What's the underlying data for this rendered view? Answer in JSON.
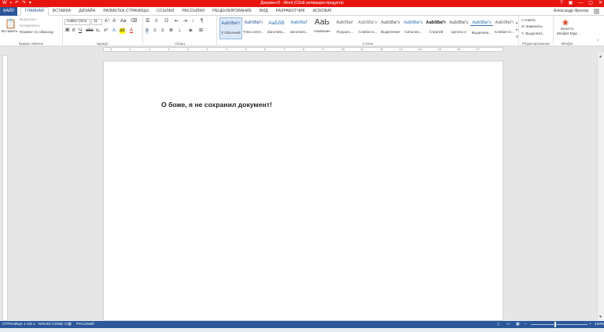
{
  "window": {
    "title": "Документ2 - Word (Сбой активации продукта)",
    "quick_access": [
      "word-icon",
      "save-icon",
      "undo-icon",
      "redo-icon",
      "customize-icon"
    ],
    "controls": [
      "?",
      "▣",
      "—",
      "▢",
      "✕"
    ]
  },
  "tabs": {
    "file": "ФАЙЛ",
    "items": [
      "ГЛАВНАЯ",
      "ВСТАВКА",
      "ДИЗАЙН",
      "РАЗМЕТКА СТРАНИЦЫ",
      "ССЫЛКИ",
      "РАССЫЛКИ",
      "РЕЦЕНЗИРОВАНИЕ",
      "ВИД",
      "РАЗРАБОТЧИК",
      "ACROBAT"
    ],
    "active": "ГЛАВНАЯ",
    "user": "Александр Фролов"
  },
  "ribbon": {
    "clipboard": {
      "paste": "Вставить",
      "cut": "Вырезать",
      "copy": "Копировать",
      "format_painter": "Формат по образцу",
      "label": "Буфер обмена"
    },
    "font": {
      "name": "Calibri (Осн",
      "size": "11",
      "label": "Шрифт"
    },
    "paragraph": {
      "label": "Абзац"
    },
    "styles": {
      "label": "Стили",
      "items": [
        {
          "preview": "АаБбВвГг",
          "name": "¶ Обычный"
        },
        {
          "preview": "АаБбВвГг",
          "name": "¶ Без инте..."
        },
        {
          "preview": "АаБбВ",
          "name": "Заголово..."
        },
        {
          "preview": "АаБбВвГ",
          "name": "Заголово..."
        },
        {
          "preview": "АаЬ",
          "name": "Название"
        },
        {
          "preview": "АаБбВвГ",
          "name": "Подзаго..."
        },
        {
          "preview": "АаБбВвГг",
          "name": "Слабое в..."
        },
        {
          "preview": "АаБбВвГг",
          "name": "Выделение"
        },
        {
          "preview": "АаБбВвГг",
          "name": "Сильное..."
        },
        {
          "preview": "АаБбВвГг",
          "name": "Строгий"
        },
        {
          "preview": "АаБбВвГг",
          "name": "Цитата 2"
        },
        {
          "preview": "АаБбВвГг",
          "name": "Выделенн..."
        },
        {
          "preview": "АаБбВвГг",
          "name": "Слабая сс..."
        }
      ]
    },
    "editing": {
      "find": "Найти",
      "replace": "Заменить",
      "select": "Выделить",
      "label": "Редактирование"
    },
    "mindjet": {
      "button": "Send to Mindjet Map",
      "label": "Mindjet"
    }
  },
  "ruler": {
    "ticks": [
      "3",
      "2",
      "1",
      "1",
      "2",
      "3",
      "4",
      "5",
      "6",
      "7",
      "8",
      "9",
      "10",
      "11",
      "12",
      "13",
      "14",
      "15",
      "16",
      "17"
    ]
  },
  "document": {
    "text": "О боже, я не сохранил документ!"
  },
  "status": {
    "page": "СТРАНИЦА 1 ИЗ 1",
    "words": "ЧИСЛО СЛОВ: 6",
    "lang": "РУССКИЙ",
    "zoom": "120%",
    "zoom_fraction": 0.43
  }
}
